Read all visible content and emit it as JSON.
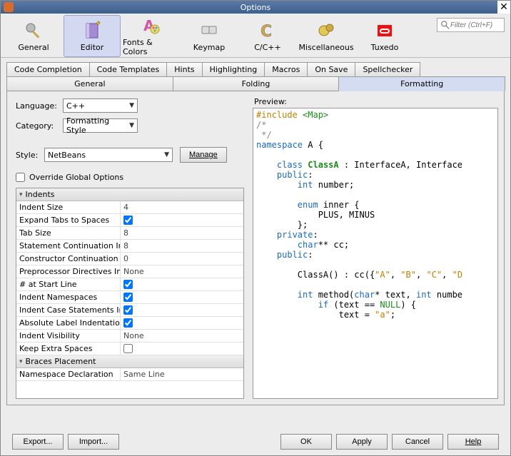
{
  "window": {
    "title": "Options"
  },
  "toolbar": {
    "categories": [
      {
        "label": "General"
      },
      {
        "label": "Editor"
      },
      {
        "label": "Fonts & Colors"
      },
      {
        "label": "Keymap"
      },
      {
        "label": "C/C++"
      },
      {
        "label": "Miscellaneous"
      },
      {
        "label": "Tuxedo"
      }
    ],
    "search_placeholder": "Filter (Ctrl+F)"
  },
  "subtabs1": [
    "Code Completion",
    "Code Templates",
    "Hints",
    "Highlighting",
    "Macros",
    "On Save",
    "Spellchecker"
  ],
  "subtabs2": [
    "General",
    "Folding",
    "Formatting"
  ],
  "form": {
    "language_label": "Language:",
    "language_value": "C++",
    "category_label": "Category:",
    "category_value": "Formatting Style",
    "style_label": "Style:",
    "style_value": "NetBeans",
    "manage_label": "Manage",
    "override_label": "Override Global Options"
  },
  "props": {
    "sections": [
      {
        "title": "Indents",
        "rows": [
          {
            "name": "Indent Size",
            "value": "4",
            "type": "text"
          },
          {
            "name": "Expand Tabs to Spaces",
            "value": true,
            "type": "check"
          },
          {
            "name": "Tab Size",
            "value": "8",
            "type": "text"
          },
          {
            "name": "Statement Continuation Indent",
            "value": "8",
            "type": "text"
          },
          {
            "name": "Constructor Continuation Initi",
            "value": "0",
            "type": "text"
          },
          {
            "name": "Preprocessor Directives Indent",
            "value": "None",
            "type": "combo"
          },
          {
            "name": "# at Start Line",
            "value": true,
            "type": "check"
          },
          {
            "name": "Indent Namespaces",
            "value": true,
            "type": "check"
          },
          {
            "name": "Indent Case Statements In Sw",
            "value": true,
            "type": "check"
          },
          {
            "name": "Absolute Label Indentation",
            "value": true,
            "type": "check"
          },
          {
            "name": "Indent Visibility",
            "value": "None",
            "type": "combo"
          },
          {
            "name": "Keep Extra Spaces",
            "value": false,
            "type": "check"
          }
        ]
      },
      {
        "title": "Braces Placement",
        "rows": [
          {
            "name": "Namespace Declaration",
            "value": "Same Line",
            "type": "combo"
          }
        ]
      }
    ]
  },
  "preview": {
    "label": "Preview:"
  },
  "buttons": {
    "export": "Export...",
    "import": "Import...",
    "ok": "OK",
    "apply": "Apply",
    "cancel": "Cancel",
    "help": "Help"
  }
}
